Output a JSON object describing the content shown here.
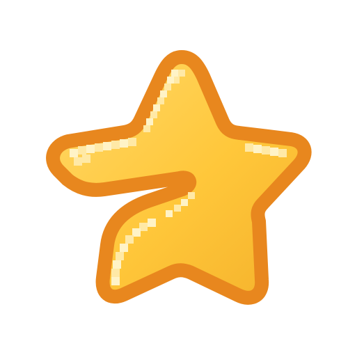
{
  "icon": {
    "semantic_name": "star-icon",
    "style": "pixelated-glossy",
    "colors": {
      "outline": "#E8871E",
      "fill_light": "#FFD96A",
      "fill_mid": "#FFC73A",
      "fill_dark": "#F4B12B",
      "highlight": "#FFF3C7",
      "highlight_soft": "#FFE9A6",
      "background": "#FFFFFF"
    }
  }
}
